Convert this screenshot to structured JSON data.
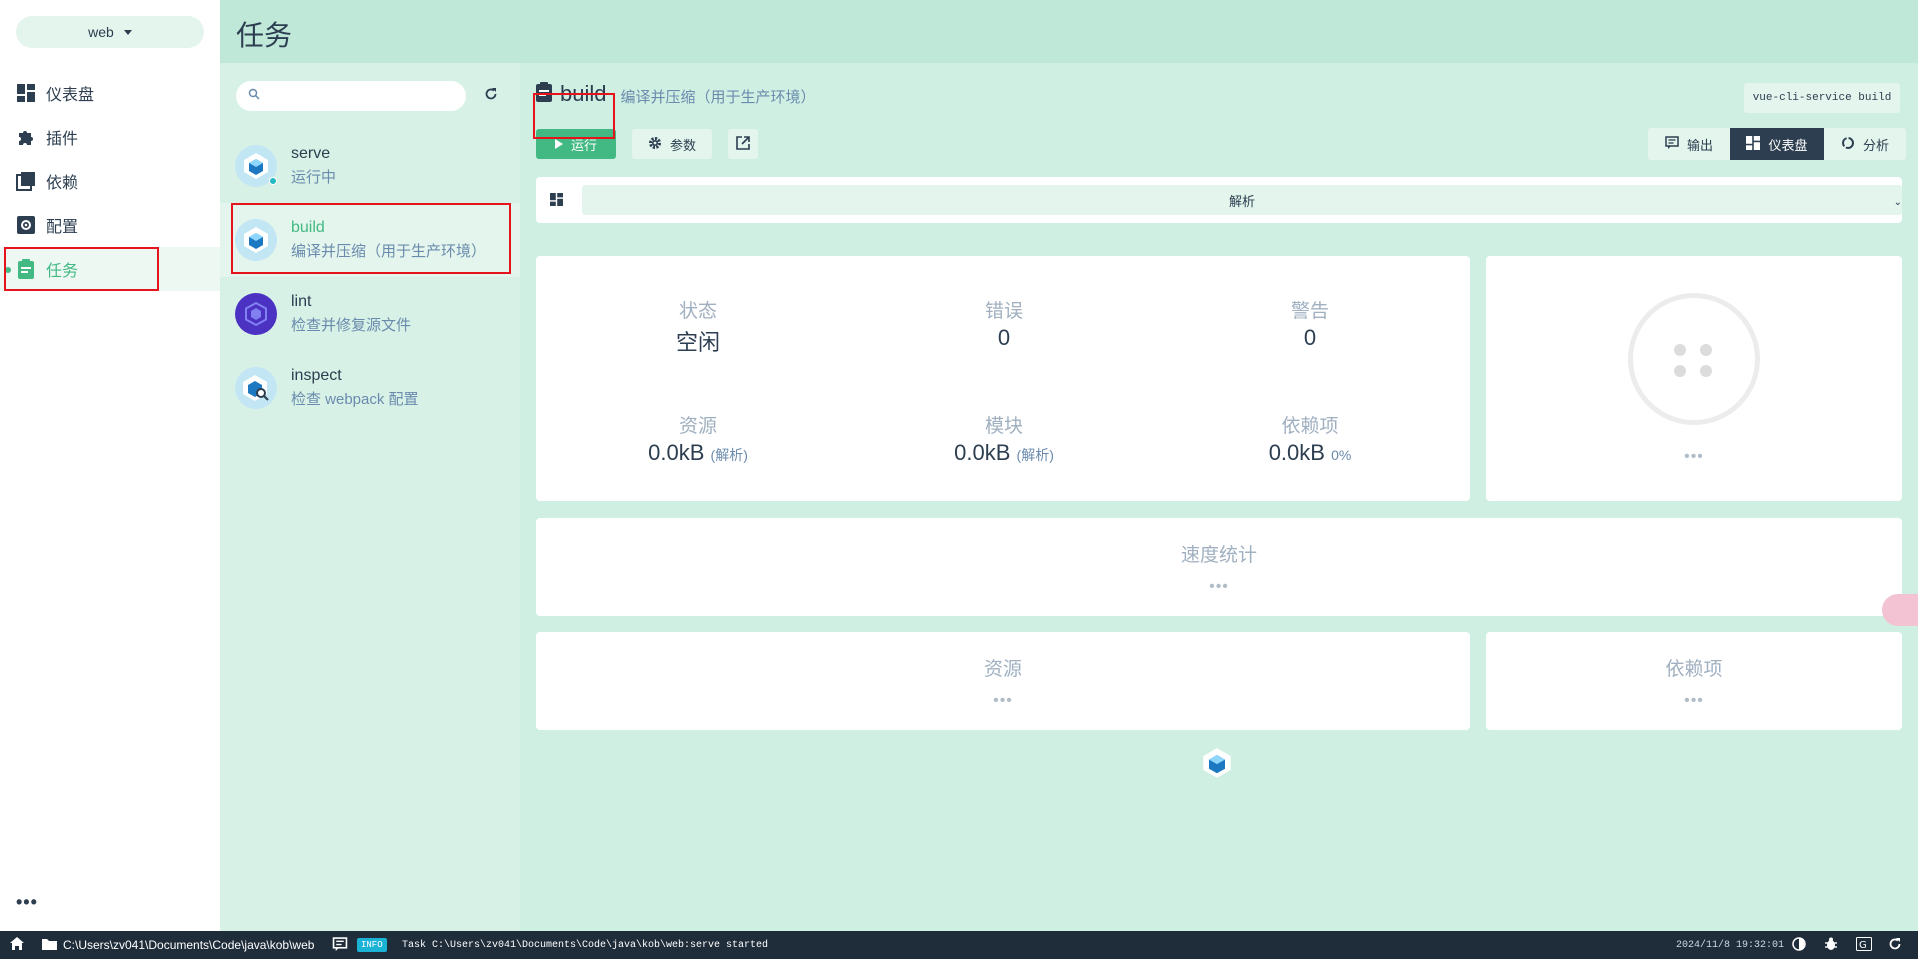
{
  "project": {
    "name": "web"
  },
  "nav": {
    "items": [
      {
        "label": "仪表盘",
        "icon": "dashboard-icon"
      },
      {
        "label": "插件",
        "icon": "puzzle-icon"
      },
      {
        "label": "依赖",
        "icon": "library-icon"
      },
      {
        "label": "配置",
        "icon": "settings-box-icon"
      },
      {
        "label": "任务",
        "icon": "clipboard-icon",
        "active": true
      }
    ],
    "more": "•••"
  },
  "header": {
    "title": "任务"
  },
  "tasks": {
    "search_placeholder": "",
    "items": [
      {
        "name": "serve",
        "desc": "运行中",
        "running": true
      },
      {
        "name": "build",
        "desc": "编译并压缩（用于生产环境）",
        "selected": true
      },
      {
        "name": "lint",
        "desc": "检查并修复源文件"
      },
      {
        "name": "inspect",
        "desc": "检查 webpack 配置"
      }
    ]
  },
  "detail": {
    "name": "build",
    "desc": "编译并压缩（用于生产环境）",
    "command": "vue-cli-service build",
    "run_label": "运行",
    "params_label": "参数",
    "views": {
      "output": "输出",
      "dashboard": "仪表盘",
      "analyze": "分析"
    },
    "mode_selector": "解析",
    "stats": {
      "status": {
        "label": "状态",
        "value": "空闲"
      },
      "errors": {
        "label": "错误",
        "value": "0"
      },
      "warnings": {
        "label": "警告",
        "value": "0"
      },
      "assets": {
        "label": "资源",
        "value": "0.0kB",
        "sub": "(解析)"
      },
      "modules": {
        "label": "模块",
        "value": "0.0kB",
        "sub": "(解析)"
      },
      "deps": {
        "label": "依赖项",
        "value": "0.0kB",
        "sub": "0%"
      }
    },
    "placeholder_dots": "•••",
    "speed_title": "速度统计",
    "assets_title": "资源",
    "deps_title": "依赖项"
  },
  "statusbar": {
    "path": "C:\\Users\\zv041\\Documents\\Code\\java\\kob\\web",
    "badge": "INFO",
    "log": "Task C:\\Users\\zv041\\Documents\\Code\\java\\kob\\web:serve started",
    "datetime": "2024/11/8 19:32:01"
  },
  "colors": {
    "accent": "#42b983",
    "dark": "#2c3e50",
    "highlight": "#e5131b"
  }
}
